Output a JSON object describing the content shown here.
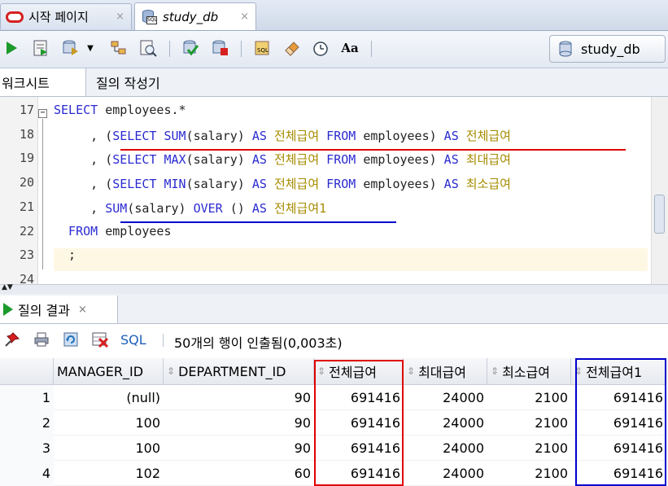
{
  "tabs": [
    {
      "label": "시작 페이지",
      "close": "×"
    },
    {
      "label": "study_db",
      "close": "×"
    }
  ],
  "toolbar": {
    "connection": "study_db"
  },
  "subtabs": {
    "worksheet": "워크시트",
    "query_builder": "질의 작성기"
  },
  "editor": {
    "lines": [
      {
        "num": "17",
        "parts": [
          [
            "kw",
            "SELECT"
          ],
          [
            "t",
            " employees.*"
          ]
        ]
      },
      {
        "num": "18",
        "parts": [
          [
            "t",
            "     , ("
          ],
          [
            "kw",
            "SELECT SUM"
          ],
          [
            "t",
            "(salary) "
          ],
          [
            "kw",
            "AS"
          ],
          [
            "t",
            " "
          ],
          [
            "ko",
            "전체급여"
          ],
          [
            "t",
            " "
          ],
          [
            "kw",
            "FROM"
          ],
          [
            "t",
            " employees) "
          ],
          [
            "kw",
            "AS"
          ],
          [
            "t",
            " "
          ],
          [
            "ko",
            "전체급여"
          ]
        ]
      },
      {
        "num": "19",
        "parts": [
          [
            "t",
            "     , ("
          ],
          [
            "kw",
            "SELECT MAX"
          ],
          [
            "t",
            "(salary) "
          ],
          [
            "kw",
            "AS"
          ],
          [
            "t",
            " "
          ],
          [
            "ko",
            "전체급여"
          ],
          [
            "t",
            " "
          ],
          [
            "kw",
            "FROM"
          ],
          [
            "t",
            " employees) "
          ],
          [
            "kw",
            "AS"
          ],
          [
            "t",
            " "
          ],
          [
            "ko",
            "최대급여"
          ]
        ]
      },
      {
        "num": "20",
        "parts": [
          [
            "t",
            "     , ("
          ],
          [
            "kw",
            "SELECT MIN"
          ],
          [
            "t",
            "(salary) "
          ],
          [
            "kw",
            "AS"
          ],
          [
            "t",
            " "
          ],
          [
            "ko",
            "전체급여"
          ],
          [
            "t",
            " "
          ],
          [
            "kw",
            "FROM"
          ],
          [
            "t",
            " employees) "
          ],
          [
            "kw",
            "AS"
          ],
          [
            "t",
            " "
          ],
          [
            "ko",
            "최소급여"
          ]
        ]
      },
      {
        "num": "21",
        "parts": [
          [
            "t",
            "     , "
          ],
          [
            "kw",
            "SUM"
          ],
          [
            "t",
            "(salary) "
          ],
          [
            "kw",
            "OVER"
          ],
          [
            "t",
            " () "
          ],
          [
            "kw",
            "AS"
          ],
          [
            "t",
            " "
          ],
          [
            "ko",
            "전체급여1"
          ]
        ]
      },
      {
        "num": "22",
        "parts": [
          [
            "kw",
            "  FROM"
          ],
          [
            "t",
            " employees"
          ]
        ]
      },
      {
        "num": "23",
        "parts": [
          [
            "t",
            "  ;"
          ]
        ]
      },
      {
        "num": "24",
        "parts": []
      }
    ]
  },
  "results": {
    "tab_label": "질의 결과",
    "tab_close": "×",
    "sql_label": "SQL",
    "status": "50개의 행이 인출됨(0,003초)",
    "columns": [
      "MANAGER_ID",
      "DEPARTMENT_ID",
      "전체급여",
      "최대급여",
      "최소급여",
      "전체급여1"
    ],
    "rows": [
      {
        "n": "1",
        "cells": [
          "(null)",
          "90",
          "691416",
          "24000",
          "2100",
          "691416"
        ]
      },
      {
        "n": "2",
        "cells": [
          "100",
          "90",
          "691416",
          "24000",
          "2100",
          "691416"
        ]
      },
      {
        "n": "3",
        "cells": [
          "100",
          "90",
          "691416",
          "24000",
          "2100",
          "691416"
        ]
      },
      {
        "n": "4",
        "cells": [
          "102",
          "60",
          "691416",
          "24000",
          "2100",
          "691416"
        ]
      }
    ]
  },
  "colors": {
    "keyword": "#2b2bd1",
    "korean": "#a58b00",
    "highlight_red": "#e00000",
    "highlight_blue": "#0000cc"
  }
}
